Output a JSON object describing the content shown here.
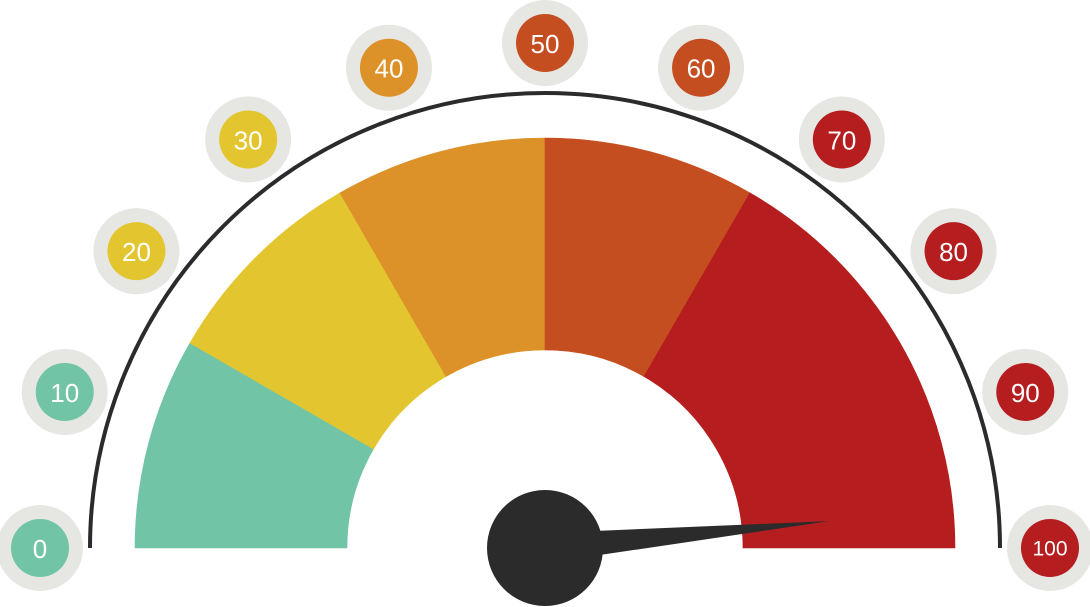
{
  "gauge": {
    "min": 0,
    "max": 100,
    "value": 97,
    "ticks": [
      {
        "label": "0",
        "color": "#72c4a7"
      },
      {
        "label": "10",
        "color": "#72c4a7"
      },
      {
        "label": "20",
        "color": "#e3c62f"
      },
      {
        "label": "30",
        "color": "#e3c62f"
      },
      {
        "label": "40",
        "color": "#dc9228"
      },
      {
        "label": "50",
        "color": "#c54e20"
      },
      {
        "label": "60",
        "color": "#c54e20"
      },
      {
        "label": "70",
        "color": "#b51d1f"
      },
      {
        "label": "80",
        "color": "#b51d1f"
      },
      {
        "label": "90",
        "color": "#b51d1f"
      },
      {
        "label": "100",
        "color": "#b51d1f"
      }
    ],
    "segments": [
      {
        "color": "#72c4a7"
      },
      {
        "color": "#e3c62f"
      },
      {
        "color": "#dc9228"
      },
      {
        "color": "#c54e20"
      },
      {
        "color": "#b51d1f"
      },
      {
        "color": "#b51d1f"
      }
    ],
    "colors": {
      "outer_arc": "#2b2b2b",
      "needle": "#2b2b2b",
      "badge_ring": "#e6e6e3"
    }
  }
}
